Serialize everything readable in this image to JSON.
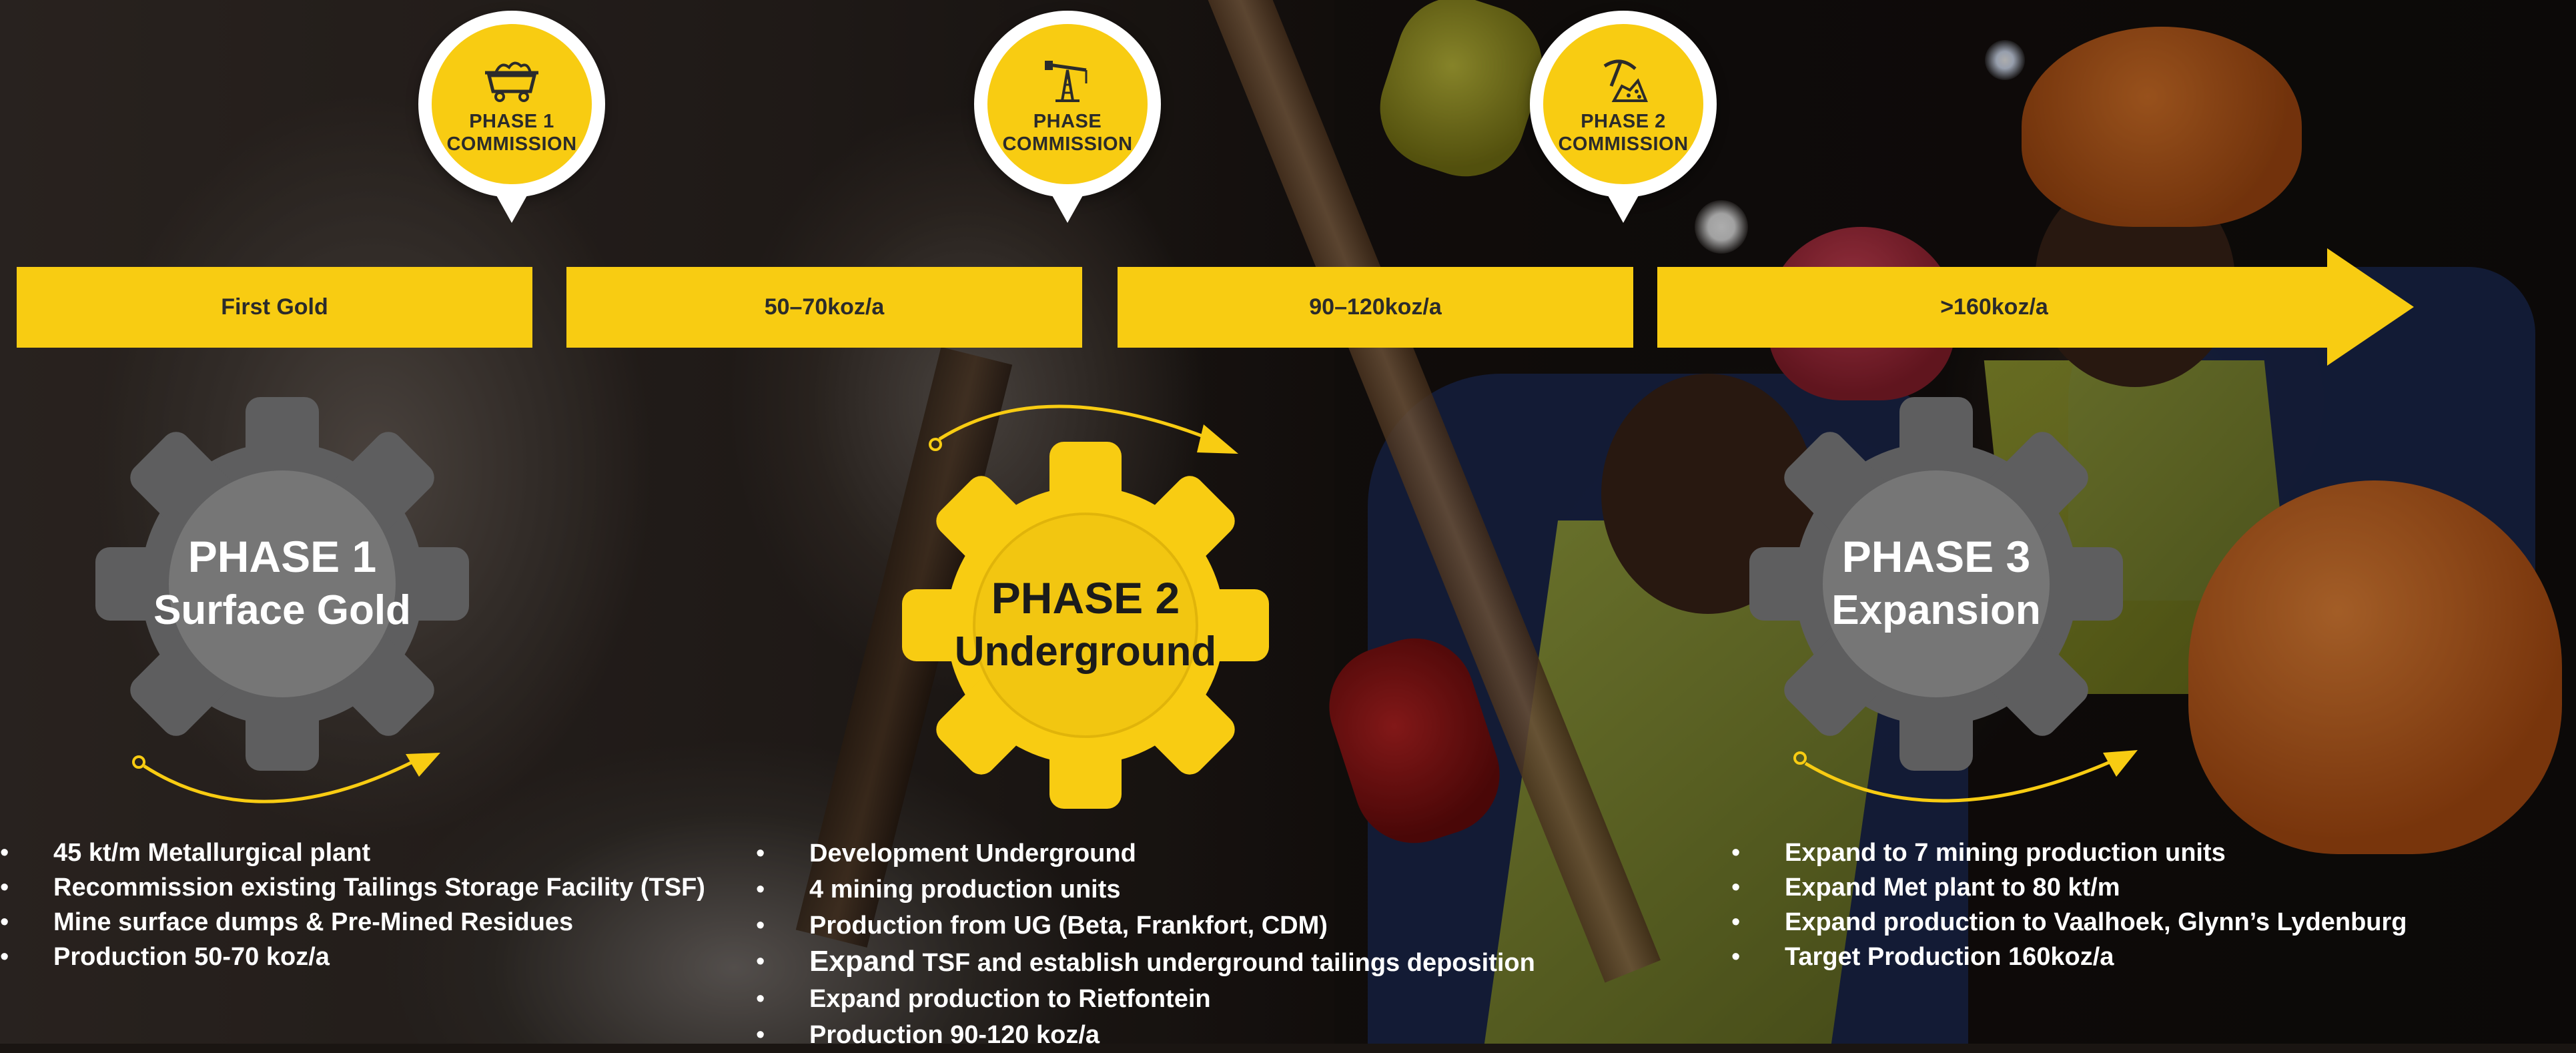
{
  "pins": [
    {
      "icon": "mine-cart-icon",
      "line1": "PHASE 1",
      "line2": "COMMISSION"
    },
    {
      "icon": "oil-derrick-icon",
      "line1": "PHASE",
      "line2": "COMMISSION"
    },
    {
      "icon": "pickaxe-ore-icon",
      "line1": "PHASE 2",
      "line2": "COMMISSION"
    }
  ],
  "timeline": [
    {
      "label": "First Gold"
    },
    {
      "label": "50–70koz/a"
    },
    {
      "label": "90–120koz/a"
    },
    {
      "label": ">160koz/a"
    }
  ],
  "phases": [
    {
      "title": "PHASE 1",
      "subtitle": "Surface Gold",
      "bullets": [
        "45 kt/m Metallurgical plant",
        "Recommission existing Tailings Storage Facility (TSF)",
        "Mine surface dumps & Pre-Mined Residues",
        "Production 50-70 koz/a"
      ]
    },
    {
      "title": "PHASE 2",
      "subtitle": "Underground",
      "bullets": [
        "Development Underground",
        "4 mining production units",
        "Production from UG (Beta, Frankfort, CDM)",
        "TSF and establish underground tailings deposition",
        "Expand production to Rietfontein",
        "Production 90-120 koz/a"
      ],
      "bullet4_lead": "Expand"
    },
    {
      "title": "PHASE 3",
      "subtitle": "Expansion",
      "bullets": [
        "Expand to 7 mining production units",
        "Expand Met plant to 80 kt/m",
        "Expand production to Vaalhoek, Glynn’s Lydenburg",
        "Target Production 160koz/a"
      ]
    }
  ],
  "colors": {
    "accent": "#f8cc12",
    "gear_grey": "#5e5e5f",
    "gear_grey_inner": "#767676",
    "text_dark": "#2b2b2b",
    "text_light": "#ffffff"
  }
}
